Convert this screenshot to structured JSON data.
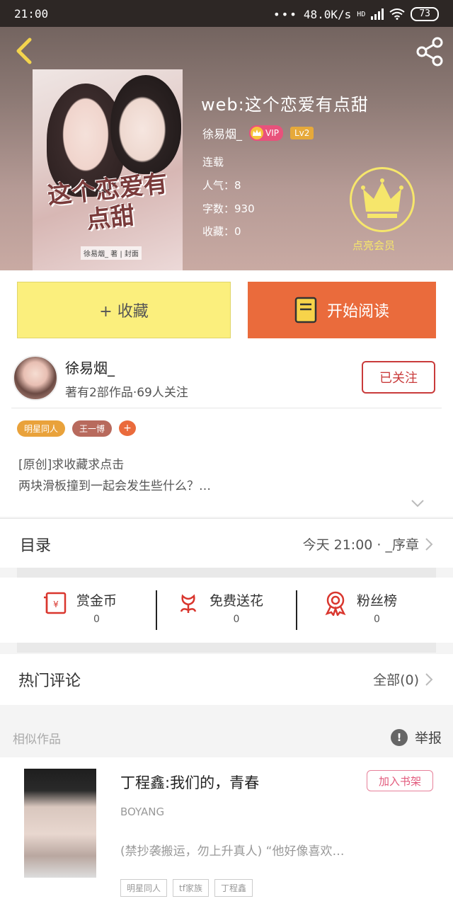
{
  "status_bar": {
    "time": "21:00",
    "network_speed": "48.0K/s",
    "network_type": "HD",
    "battery": "73"
  },
  "book": {
    "title": "web:这个恋爱有点甜",
    "author": "徐易烟_",
    "vip_label": "VIP",
    "level": "Lv2",
    "status": "连载",
    "popularity": "人气：8",
    "word_count": "字数：930",
    "collections": "收藏：0",
    "cover_title": "这个恋爱有点甜",
    "cover_credits": "徐易烟_ 著 | 封面"
  },
  "member_label": "点亮会员",
  "buttons": {
    "collect": "+ 收藏",
    "read": "开始阅读"
  },
  "author_card": {
    "name": "徐易烟_",
    "info": "著有2部作品·69人关注",
    "follow_label": "已关注"
  },
  "tags": [
    {
      "label": "明星同人",
      "color": "#e9a23b"
    },
    {
      "label": "王一博",
      "color": "#b86a5d"
    }
  ],
  "description": {
    "line1": "[原创]求收藏求点击",
    "line2": "两块滑板撞到一起会发生些什么？…"
  },
  "catalog": {
    "label": "目录",
    "latest": "今天 21:00 · _序章"
  },
  "rewards": [
    {
      "name": "赏金币",
      "count": "0",
      "icon": "red-envelope-icon"
    },
    {
      "name": "免费送花",
      "count": "0",
      "icon": "flower-icon"
    },
    {
      "name": "粉丝榜",
      "count": "0",
      "icon": "medal-icon"
    }
  ],
  "comments": {
    "label": "热门评论",
    "all_label": "全部(0)"
  },
  "similar": {
    "heading": "相似作品",
    "report_label": "举报",
    "items": [
      {
        "title": "丁程鑫:我们的，青春",
        "author": "BOYANG",
        "description": "(禁抄袭搬运，勿上升真人) “他好像喜欢…",
        "tags": [
          "明星同人",
          "tf家族",
          "丁程鑫"
        ],
        "shelf_label": "加入书架"
      }
    ]
  },
  "colors": {
    "accent_orange": "#ea6b3c",
    "collect_yellow": "#fbef7d",
    "follow_red": "#c93b3b",
    "member_gold": "#f6e66b"
  }
}
